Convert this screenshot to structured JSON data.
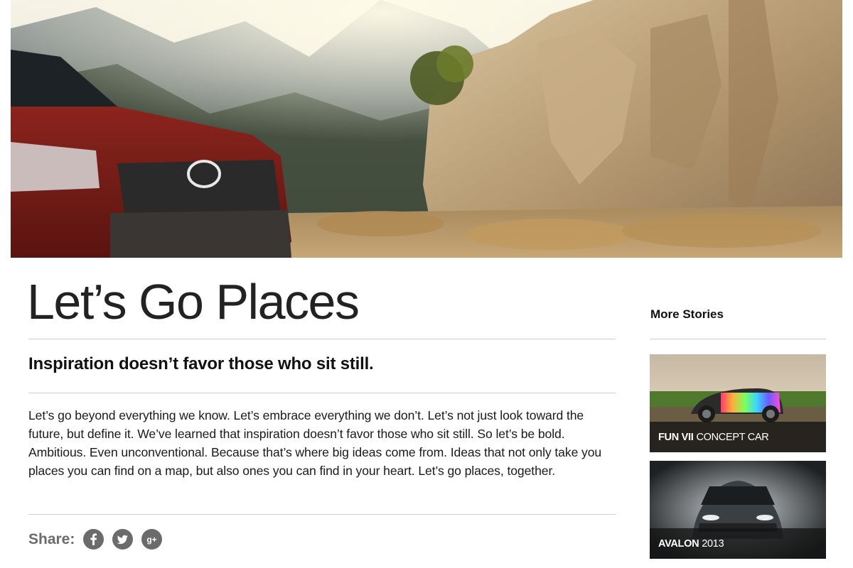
{
  "hero": {
    "image": "toyota-4runner-mountain-hero"
  },
  "main": {
    "title": "Let’s Go Places",
    "subtitle": "Inspiration doesn’t favor those who sit still.",
    "body": "Let’s go beyond everything we know. Let’s embrace everything we don’t. Let’s not just look toward the future, but define it. We’ve learned that inspiration doesn’t favor those who sit still. So let’s be bold. Ambitious. Even unconventional. Because that’s where big ideas come from. Ideas that not only take you places you can find on a map, but also ones you can find in your heart. Let’s go places, together.",
    "share_label": "Share:",
    "social": [
      {
        "icon": "facebook-icon",
        "glyph": "f"
      },
      {
        "icon": "twitter-icon",
        "glyph": "t"
      },
      {
        "icon": "google-plus-icon",
        "glyph": "g+"
      }
    ]
  },
  "sidebar": {
    "title": "More Stories",
    "stories": [
      {
        "bold": "FUN VII",
        "rest": "CONCEPT CAR"
      },
      {
        "bold": "AVALON",
        "rest": "2013"
      }
    ]
  },
  "colors": {
    "text": "#111111",
    "muted": "#6b6b6b",
    "rule": "#cfcfcf",
    "caption_bg": "#141414"
  }
}
